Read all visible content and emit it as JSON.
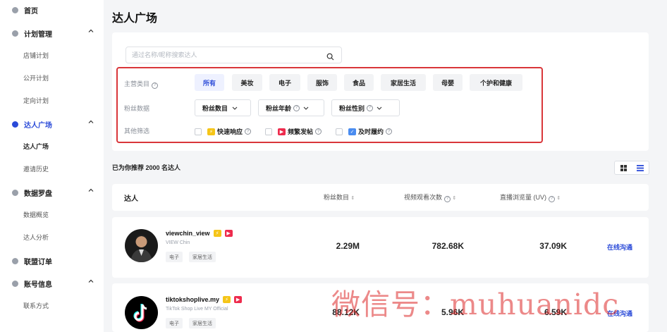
{
  "sidebar": {
    "home": "首页",
    "plan_mgmt": "计划管理",
    "store_plan": "店铺计划",
    "public_plan": "公开计划",
    "targeted_plan": "定向计划",
    "creator_square": "达人广场",
    "creator_square_sub": "达人广场",
    "invite_history": "邀请历史",
    "data_compass": "数据罗盘",
    "data_overview": "数据概览",
    "creator_analysis": "达人分析",
    "affiliate_orders": "联盟订单",
    "account_info": "账号信息",
    "contact": "联系方式"
  },
  "page": {
    "title": "达人广场"
  },
  "search": {
    "placeholder": "通过名称/昵称搜索达人"
  },
  "filters": {
    "category_label": "主营类目",
    "categories": [
      "所有",
      "美妆",
      "电子",
      "服饰",
      "食品",
      "家居生活",
      "母婴",
      "个护和健康"
    ],
    "fans_label": "粉丝数据",
    "fans_count": "粉丝数目",
    "fans_age": "粉丝年龄",
    "fans_gender": "粉丝性别",
    "other_label": "其他筛选",
    "quick_response": "快速响应",
    "frequent_posting": "频繁发帖",
    "timely_fulfill": "及时履约"
  },
  "results": {
    "count_text": "已为你推荐 2000 名达人"
  },
  "table": {
    "col_creator": "达人",
    "col_fans": "粉丝数目",
    "col_views": "视频观看次数",
    "col_live": "直播浏览量 (UV)"
  },
  "creators": [
    {
      "name": "viewchin_view",
      "display": "VIEW Chin",
      "tags": [
        "电子",
        "家居生活"
      ],
      "fans": "2.29M",
      "views": "782.68K",
      "live": "37.09K",
      "action": "在线沟通"
    },
    {
      "name": "tiktokshoplive.my",
      "display": "TikTok Shop Live MY Official",
      "tags": [
        "电子",
        "家居生活"
      ],
      "fans": "88.12K",
      "views": "5.96K",
      "live": "6.59K",
      "action": "在线沟通"
    }
  ],
  "watermark": "微信号：muhuanidc",
  "colors": {
    "accent": "#2a4ad8",
    "highlight_border": "#d9363a",
    "badge_yellow": "#f5c518",
    "badge_red": "#ee2b4d",
    "badge_blue": "#4a8cf0"
  }
}
